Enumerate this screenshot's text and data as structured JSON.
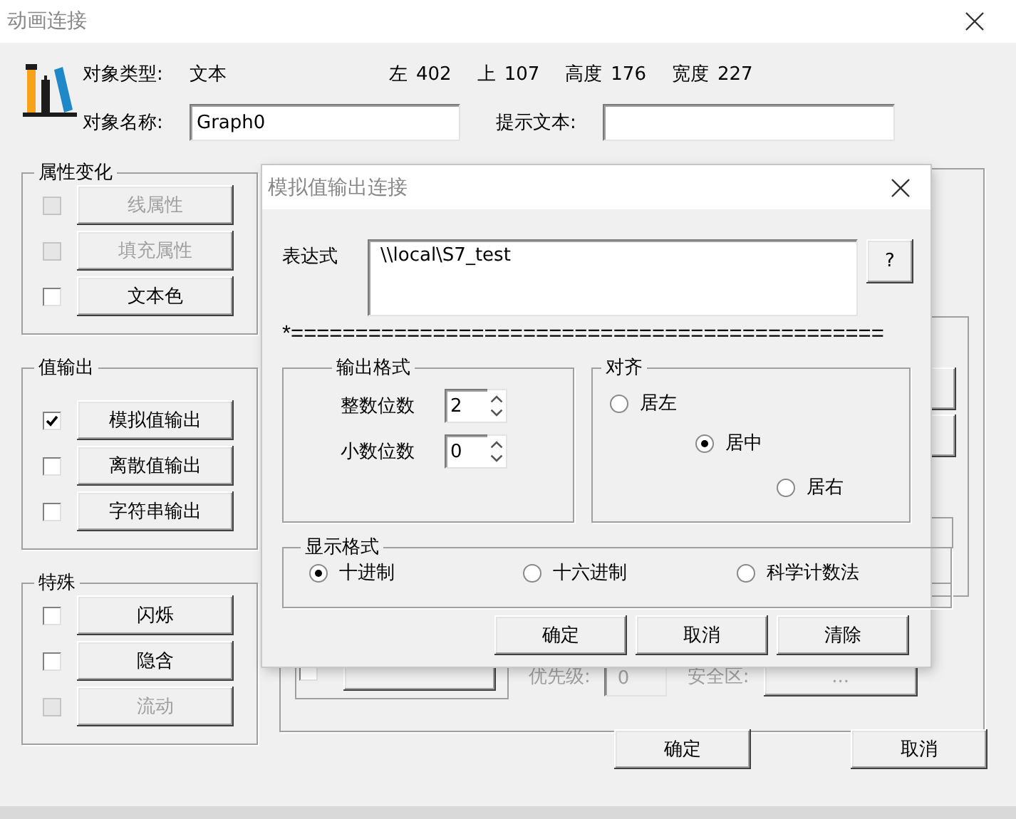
{
  "window": {
    "title": "动画连接"
  },
  "object": {
    "type_label": "对象类型:",
    "type_value": "文本",
    "name_label": "对象名称:",
    "name_value": "Graph0",
    "hint_label": "提示文本:"
  },
  "geometry": [
    {
      "label": "左",
      "value": "402"
    },
    {
      "label": "上",
      "value": "107"
    },
    {
      "label": "高度",
      "value": "176"
    },
    {
      "label": "宽度",
      "value": "227"
    }
  ],
  "groups": [
    {
      "title": "属性变化",
      "items": [
        {
          "label": "线属性",
          "checked": false,
          "disabled": true
        },
        {
          "label": "填充属性",
          "checked": false,
          "disabled": true
        },
        {
          "label": "文本色",
          "checked": false,
          "disabled": false
        }
      ]
    },
    {
      "title": "值输出",
      "items": [
        {
          "label": "模拟值输出",
          "checked": true,
          "disabled": false
        },
        {
          "label": "离散值输出",
          "checked": false,
          "disabled": false
        },
        {
          "label": "字符串输出",
          "checked": false,
          "disabled": false
        }
      ]
    },
    {
      "title": "特殊",
      "items": [
        {
          "label": "闪烁",
          "checked": false,
          "disabled": false
        },
        {
          "label": "隐含",
          "checked": false,
          "disabled": false
        },
        {
          "label": "流动",
          "checked": false,
          "disabled": true
        }
      ]
    }
  ],
  "right_panel": {
    "checked": false,
    "priority_label": "优先级:",
    "priority_value": "0",
    "safety_label": "安全区:",
    "safety_button": "..."
  },
  "buttons": [
    "确定",
    "取消"
  ],
  "dialog": {
    "title": "模拟值输出连接",
    "expression_label": "表达式",
    "expression": "\\\\local\\S7_test",
    "help_button": "?",
    "separator": "*==============================================",
    "output_format": {
      "title": "输出格式",
      "fields": [
        {
          "label": "整数位数",
          "value": "2"
        },
        {
          "label": "小数位数",
          "value": "0"
        }
      ]
    },
    "align": {
      "title": "对齐",
      "options": [
        {
          "label": "居左",
          "selected": false
        },
        {
          "label": "居中",
          "selected": true
        },
        {
          "label": "居右",
          "selected": false
        }
      ]
    },
    "display": {
      "title": "显示格式",
      "options": [
        {
          "label": "十进制",
          "selected": true
        },
        {
          "label": "十六进制",
          "selected": false
        },
        {
          "label": "科学计数法",
          "selected": false
        }
      ]
    },
    "buttons": [
      "确定",
      "取消",
      "清除"
    ]
  }
}
